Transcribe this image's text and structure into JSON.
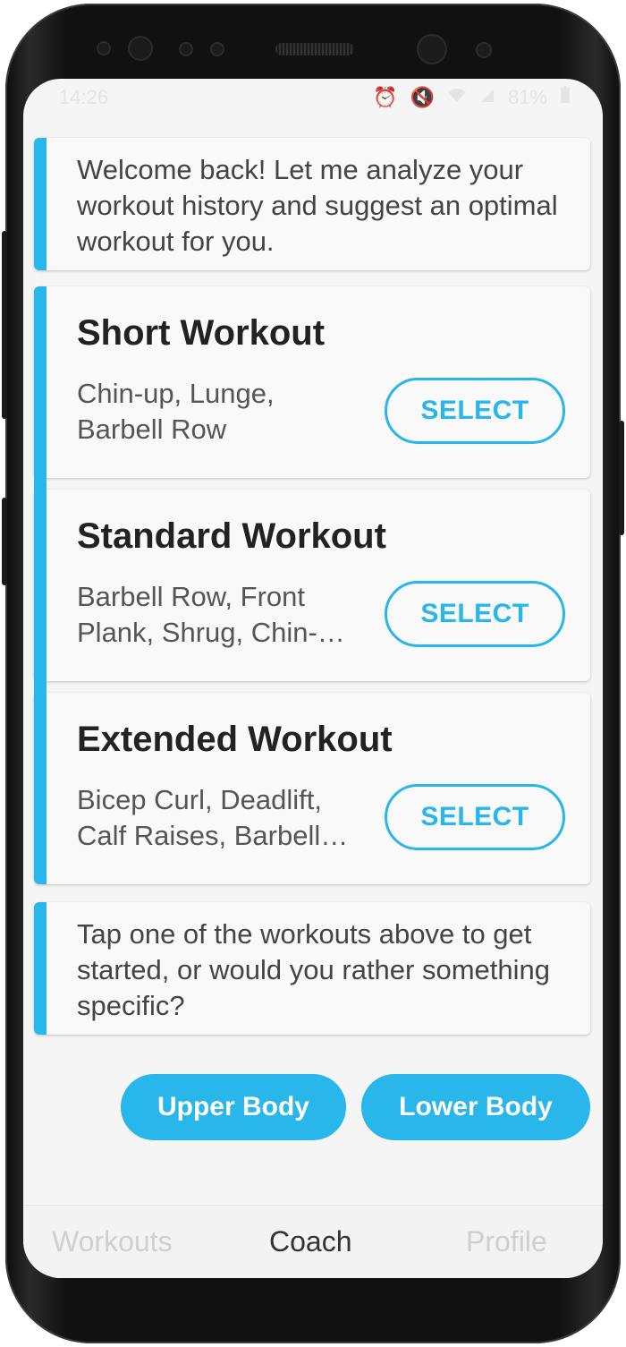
{
  "status_bar": {
    "time": "14:26",
    "icons": [
      "alarm-icon",
      "mute-icon",
      "wifi-icon",
      "signal-icon"
    ],
    "battery": "81%"
  },
  "chat": {
    "welcome": "Welcome back! Let me analyze your workout history and suggest an optimal workout for you.",
    "workouts": [
      {
        "title": "Short Workout",
        "exercises": "Chin-up, Lunge, Barbell Row",
        "action": "SELECT"
      },
      {
        "title": "Standard Workout",
        "exercises": "Barbell Row, Front Plank, Shrug, Chin-…",
        "action": "SELECT"
      },
      {
        "title": "Extended Workout",
        "exercises": "Bicep Curl, Deadlift, Calf Raises, Barbell…",
        "action": "SELECT"
      }
    ],
    "prompt": "Tap one of the workouts above to get started, or would you rather something specific?",
    "quick_replies": [
      "Upper Body",
      "Lower Body"
    ]
  },
  "tabs": [
    {
      "label": "Workouts",
      "active": false
    },
    {
      "label": "Coach",
      "active": true
    },
    {
      "label": "Profile",
      "active": false
    }
  ],
  "colors": {
    "accent": "#29b6ea",
    "background": "#f5f5f5",
    "card": "#f9f9f9"
  }
}
